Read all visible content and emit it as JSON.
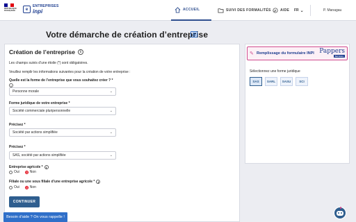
{
  "header": {
    "marianne_text": [
      "RÉPUBLIQUE",
      "FRANÇAISE",
      "Liberté",
      "Égalité",
      "Fraternité"
    ],
    "brand_line1": "ENTREPRISES",
    "brand_line2": "inpi",
    "nav_home": "ACCUEIL",
    "nav_followup": "SUIVI DES FORMALITÉS",
    "nav_help": "AIDE",
    "lang": "FR",
    "user": "P. Managau"
  },
  "page_title": "Votre démarche de création d’entreprise",
  "form": {
    "section_title": "Création de l’entreprise",
    "required_note": "Les champs suivis d’une étoile (*) sont obligatoires.",
    "instructions": "Veuillez remplir les informations suivantes pour la création de votre entreprise :",
    "q1_label": "Quelle est la forme de l’entreprise que vous souhaitez créer ? *",
    "q1_value": "Personne morale",
    "q2_label": "Forme juridique de votre entreprise *",
    "q2_value": "Société commerciale pluripersonnelle",
    "q3_label": "Précisez *",
    "q3_value": "Société par actions simplifiée",
    "q4_label": "Précisez *",
    "q4_value": "SAS, société par actions simplifiée",
    "agri_label": "Entreprise agricole *",
    "agri_yes": "Oui",
    "agri_no": "Non",
    "subsidiary_label": "Filiale ou une sous filiale d’une entreprise agricole *",
    "sub_yes": "Oui",
    "sub_no": "Non",
    "continue_label": "CONTINUER"
  },
  "panel": {
    "title": "Remplissage du formulaire INPI",
    "logo_text": "Pappers",
    "logo_sub": "Services",
    "subtitle": "Sélectionnez une forme juridique",
    "chips": [
      "SAS",
      "SARL",
      "SASU",
      "SCI"
    ]
  },
  "footer": {
    "help_text": "Besoin d’aide ? On vous rappelle !"
  },
  "colors": {
    "primary": "#2f5e8f",
    "accent_red": "#e1000f",
    "pappers_pink": "#d04a8e",
    "help_blue": "#2f6fc9"
  }
}
